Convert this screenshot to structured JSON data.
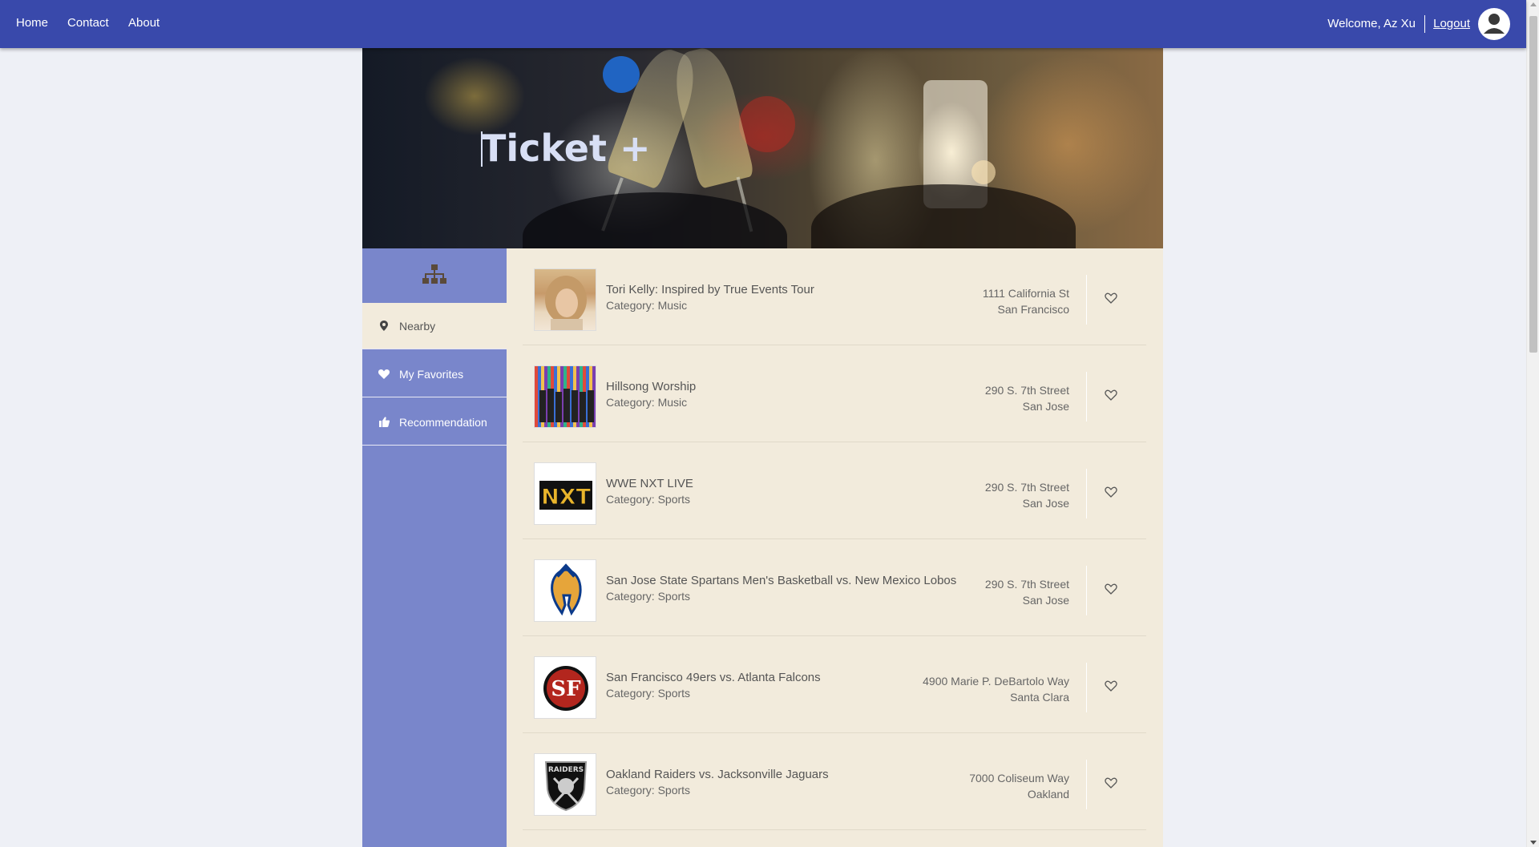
{
  "nav": {
    "links": [
      "Home",
      "Contact",
      "About"
    ],
    "welcome": "Welcome, Az Xu",
    "logout": "Logout"
  },
  "hero": {
    "title": "Ticket +"
  },
  "sidebar": {
    "items": [
      {
        "label": "Nearby",
        "icon": "map-pin-icon",
        "active": true
      },
      {
        "label": "My Favorites",
        "icon": "heart-icon",
        "active": false
      },
      {
        "label": "Recommendation",
        "icon": "thumbs-up-icon",
        "active": false
      }
    ]
  },
  "events": [
    {
      "name": "Tori Kelly: Inspired by True Events Tour",
      "category": "Category: Music",
      "street": "1111 California St",
      "city": "San Francisco"
    },
    {
      "name": "Hillsong Worship",
      "category": "Category: Music",
      "street": "290 S. 7th Street",
      "city": "San Jose"
    },
    {
      "name": "WWE NXT LIVE",
      "category": "Category: Sports",
      "street": "290 S. 7th Street",
      "city": "San Jose"
    },
    {
      "name": "San Jose State Spartans Men's Basketball vs. New Mexico Lobos",
      "category": "Category: Sports",
      "street": "290 S. 7th Street",
      "city": "San Jose"
    },
    {
      "name": "San Francisco 49ers vs. Atlanta Falcons",
      "category": "Category: Sports",
      "street": "4900 Marie P. DeBartolo Way",
      "city": "Santa Clara"
    },
    {
      "name": "Oakland Raiders vs. Jacksonville Jaguars",
      "category": "Category: Sports",
      "street": "7000 Coliseum Way",
      "city": "Oakland"
    }
  ],
  "colors": {
    "navbar": "#3949ab",
    "sidebar": "#7986cb",
    "content_bg": "#f2ebdc"
  }
}
